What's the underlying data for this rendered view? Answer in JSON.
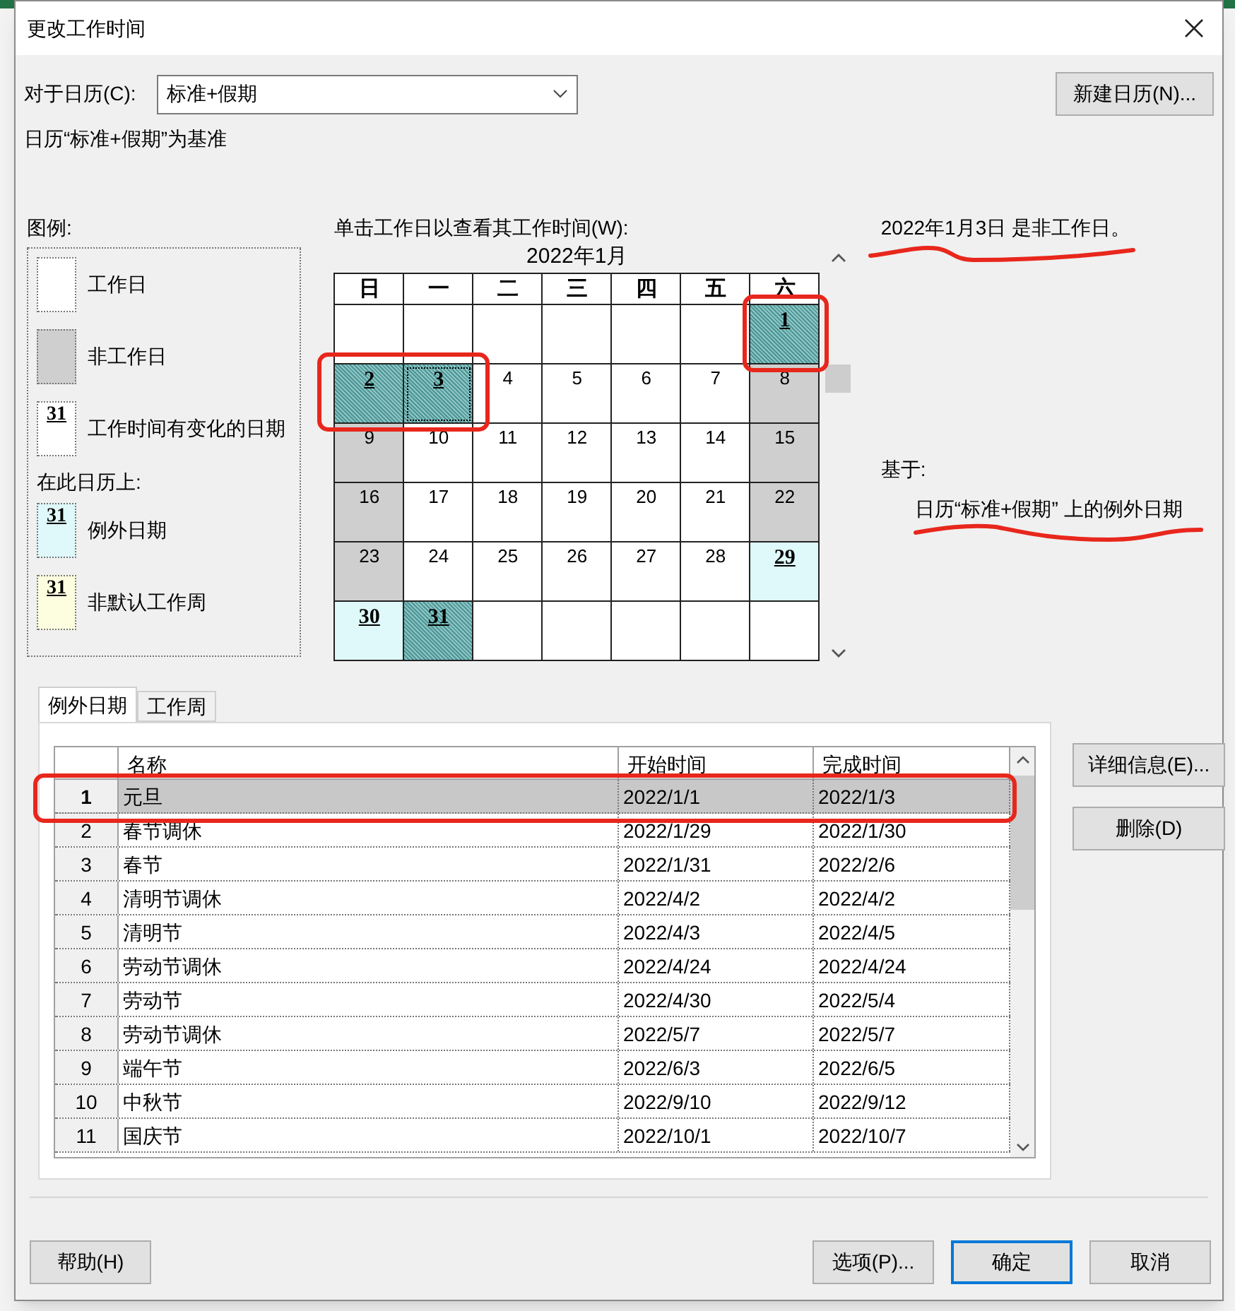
{
  "window": {
    "title": "更改工作时间"
  },
  "calendar_field": {
    "label": "对于日历(C):",
    "value": "标准+假期"
  },
  "new_calendar_button": "新建日历(N)...",
  "base_note": "日历“标准+假期”为基准",
  "legend": {
    "title": "图例:",
    "items": [
      {
        "kind": "work",
        "label": "工作日"
      },
      {
        "kind": "nonwork",
        "label": "非工作日"
      },
      {
        "kind": "changed",
        "swatch": "31",
        "label": "工作时间有变化的日期"
      },
      {
        "kind": "heading",
        "label": "在此日历上:"
      },
      {
        "kind": "exception",
        "swatch": "31",
        "label": "例外日期"
      },
      {
        "kind": "nondefault",
        "swatch": "31",
        "label": "非默认工作周"
      }
    ]
  },
  "calendar": {
    "label": "单击工作日以查看其工作时间(W):",
    "month": "2022年1月",
    "weekdays": [
      "日",
      "一",
      "二",
      "三",
      "四",
      "五",
      "六"
    ],
    "cells": [
      {
        "kind": "blank",
        "focused": false
      },
      {
        "kind": "blank",
        "focused": false
      },
      {
        "kind": "blank",
        "focused": false
      },
      {
        "kind": "blank",
        "focused": false
      },
      {
        "kind": "blank",
        "focused": false
      },
      {
        "kind": "blank",
        "focused": false
      },
      {
        "day": "1",
        "kind": "selected",
        "focused": false
      },
      {
        "day": "2",
        "kind": "selected",
        "focused": false
      },
      {
        "day": "3",
        "kind": "selected",
        "focused": true
      },
      {
        "day": "4",
        "kind": "work",
        "focused": false
      },
      {
        "day": "5",
        "kind": "work",
        "focused": false
      },
      {
        "day": "6",
        "kind": "work",
        "focused": false
      },
      {
        "day": "7",
        "kind": "work",
        "focused": false
      },
      {
        "day": "8",
        "kind": "nonwork",
        "focused": false
      },
      {
        "day": "9",
        "kind": "nonwork",
        "focused": false
      },
      {
        "day": "10",
        "kind": "work",
        "focused": false
      },
      {
        "day": "11",
        "kind": "work",
        "focused": false
      },
      {
        "day": "12",
        "kind": "work",
        "focused": false
      },
      {
        "day": "13",
        "kind": "work",
        "focused": false
      },
      {
        "day": "14",
        "kind": "work",
        "focused": false
      },
      {
        "day": "15",
        "kind": "nonwork",
        "focused": false
      },
      {
        "day": "16",
        "kind": "nonwork",
        "focused": false
      },
      {
        "day": "17",
        "kind": "work",
        "focused": false
      },
      {
        "day": "18",
        "kind": "work",
        "focused": false
      },
      {
        "day": "19",
        "kind": "work",
        "focused": false
      },
      {
        "day": "20",
        "kind": "work",
        "focused": false
      },
      {
        "day": "21",
        "kind": "work",
        "focused": false
      },
      {
        "day": "22",
        "kind": "nonwork",
        "focused": false
      },
      {
        "day": "23",
        "kind": "nonwork",
        "focused": false
      },
      {
        "day": "24",
        "kind": "work",
        "focused": false
      },
      {
        "day": "25",
        "kind": "work",
        "focused": false
      },
      {
        "day": "26",
        "kind": "work",
        "focused": false
      },
      {
        "day": "27",
        "kind": "work",
        "focused": false
      },
      {
        "day": "28",
        "kind": "work",
        "focused": false
      },
      {
        "day": "29",
        "kind": "exception",
        "focused": false
      },
      {
        "day": "30",
        "kind": "exception",
        "focused": false
      },
      {
        "day": "31",
        "kind": "selected",
        "focused": false
      },
      {
        "kind": "blank",
        "focused": false
      },
      {
        "kind": "blank",
        "focused": false
      },
      {
        "kind": "blank",
        "focused": false
      },
      {
        "kind": "blank",
        "focused": false
      },
      {
        "kind": "blank",
        "focused": false
      }
    ]
  },
  "status": "2022年1月3日 是非工作日。",
  "based_on": {
    "label": "基于:",
    "text": "日历“标准+假期” 上的例外日期"
  },
  "tabs": [
    {
      "label": "例外日期",
      "selected": true
    },
    {
      "label": "工作周",
      "selected": false
    }
  ],
  "table": {
    "columns": [
      "名称",
      "开始时间",
      "完成时间"
    ],
    "rows": [
      {
        "num": "1",
        "name": "元旦",
        "start": "2022/1/1",
        "end": "2022/1/3",
        "selected": true
      },
      {
        "num": "2",
        "name": "春节调休",
        "start": "2022/1/29",
        "end": "2022/1/30",
        "selected": false
      },
      {
        "num": "3",
        "name": "春节",
        "start": "2022/1/31",
        "end": "2022/2/6",
        "selected": false
      },
      {
        "num": "4",
        "name": "清明节调休",
        "start": "2022/4/2",
        "end": "2022/4/2",
        "selected": false
      },
      {
        "num": "5",
        "name": "清明节",
        "start": "2022/4/3",
        "end": "2022/4/5",
        "selected": false
      },
      {
        "num": "6",
        "name": "劳动节调休",
        "start": "2022/4/24",
        "end": "2022/4/24",
        "selected": false
      },
      {
        "num": "7",
        "name": "劳动节",
        "start": "2022/4/30",
        "end": "2022/5/4",
        "selected": false
      },
      {
        "num": "8",
        "name": "劳动节调休",
        "start": "2022/5/7",
        "end": "2022/5/7",
        "selected": false
      },
      {
        "num": "9",
        "name": "端午节",
        "start": "2022/6/3",
        "end": "2022/6/5",
        "selected": false
      },
      {
        "num": "10",
        "name": "中秋节",
        "start": "2022/9/10",
        "end": "2022/9/12",
        "selected": false
      },
      {
        "num": "11",
        "name": "国庆节",
        "start": "2022/10/1",
        "end": "2022/10/7",
        "selected": false
      }
    ]
  },
  "side_buttons": [
    "详细信息(E)...",
    "删除(D)"
  ],
  "footer": {
    "help": "帮助(H)",
    "buttons": [
      {
        "label": "选项(P)...",
        "default": false
      },
      {
        "label": "确定",
        "default": true
      },
      {
        "label": "取消",
        "default": false
      }
    ]
  }
}
